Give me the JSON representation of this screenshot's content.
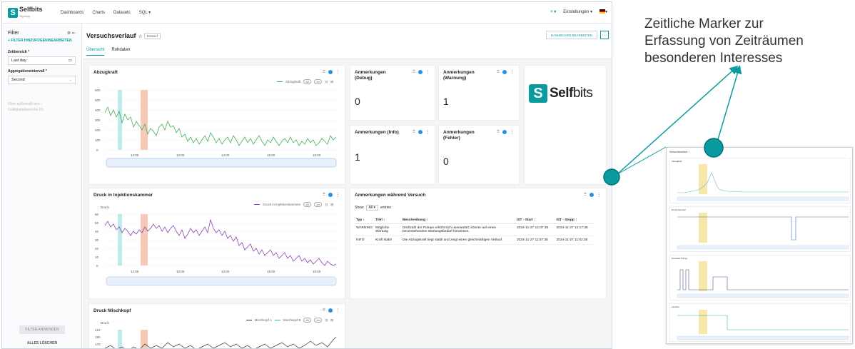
{
  "nav": {
    "logo_text": "Selfbits",
    "logo_sub": "SignApp",
    "links": [
      "Dashboards",
      "Charts",
      "Datasets",
      "SQL ▾"
    ],
    "plus": "+ ▾",
    "settings": "Einstellungen ▾",
    "lang": "▾"
  },
  "sidebar": {
    "title": "Filter",
    "add_filter": "+ FILTER HINZUFÜGEN/BEARBEITEN",
    "zeitbereich_label": "Zeitbereich *",
    "zeitbereich_value": "Last day",
    "agg_label": "Aggregationsintervall *",
    "agg_value": "Second",
    "muted_line1": "Filter außerhalb des",
    "muted_line2": "Gültigkeitsbereichs (0)",
    "apply": "FILTER ANWENDEN",
    "clear": "ALLES LÖSCHEN"
  },
  "header": {
    "title": "Versuchsverlauf",
    "badge": "Entwurf",
    "edit_button": "DASHBOARD BEARBEITEN",
    "more": "···",
    "tabs": [
      "Übersicht",
      "Rohdaten"
    ]
  },
  "cards": {
    "abzugkraft": {
      "title": "Abzugkraft",
      "legend": "Abzugkraft",
      "yticks": [
        "600",
        "500",
        "400",
        "300",
        "200",
        "100",
        "0"
      ],
      "xticks": [
        "12:00",
        "13:00",
        "14:00",
        "15:00",
        "16:00"
      ]
    },
    "kpi_debug": {
      "title_line1": "Anmerkungen",
      "title_line2": "(Debug)",
      "value": "0"
    },
    "kpi_warn": {
      "title_line1": "Anmerkungen",
      "title_line2": "(Warnung)",
      "value": "1"
    },
    "kpi_info": {
      "title_line1": "Anmerkungen (Info)",
      "value": "1"
    },
    "kpi_err": {
      "title_line1": "Anmerkungen",
      "title_line2": "(Fehler)",
      "value": "0"
    },
    "logo": {
      "bold": "Self",
      "thin": "bits"
    },
    "druck_injektion": {
      "title": "Druck in Injektionskammer",
      "legend": "Druck in Injektionskammer",
      "yunit": "Druck",
      "yticks": [
        "60",
        "50",
        "40",
        "30",
        "20",
        "10",
        "0"
      ],
      "xticks": [
        "12:00",
        "13:00",
        "14:00",
        "15:00",
        "16:00"
      ]
    },
    "anmerkungen_table": {
      "title": "Anmerkungen während Versuch",
      "show": "Show",
      "show_sel": "All ▾",
      "entries": "entries",
      "columns": [
        "Typ ↕",
        "Titel ↕",
        "Beschreibung ↕",
        "IST - Start ↕",
        "IST - Stopp ↕"
      ],
      "rows": [
        [
          "WARNING",
          "Mögliche Wartung",
          "Drehzahl der Pumpe erhöht sich unerwartet; könnte auf einen bevorstehenden Wartungsbedarf hinweisen.",
          "2024-11-27 12:07:35",
          "2024-11-27 12:17:35"
        ],
        [
          "INFO",
          "Kraft stabil",
          "Die Abzugskraft liegt stabil und zeigt einen gleichmäßigen Verlauf.",
          "2024-11-27 11:57:35",
          "2024-11-27 11:62:35"
        ]
      ]
    },
    "druck_mischkopf": {
      "title": "Druck Mischkopf",
      "legend_a": "Mischkopf A",
      "legend_b": "Mischkopf B",
      "yunit": "Druck",
      "yticks": [
        "210",
        "190",
        "170"
      ]
    }
  },
  "annotation": {
    "text_line1": "Zeitliche Marker zur",
    "text_line2": "Erfassung von Zeiträumen",
    "text_line3": "besonderen Interesses"
  },
  "thumbnail": {
    "title": "Versuchsverlauf ☆",
    "panels": [
      "Abzugkraft",
      "Druck Kammer",
      "Drehzahl Pumpe",
      "Laufzeit"
    ]
  },
  "colors": {
    "accent": "#0a9ba0",
    "marker_cyan": "#bfe9ea",
    "marker_orange": "#f7c9b6",
    "marker_yellow": "#f7e7a8",
    "green_series": "#3fae5a",
    "purple_series": "#8a3fb0"
  }
}
